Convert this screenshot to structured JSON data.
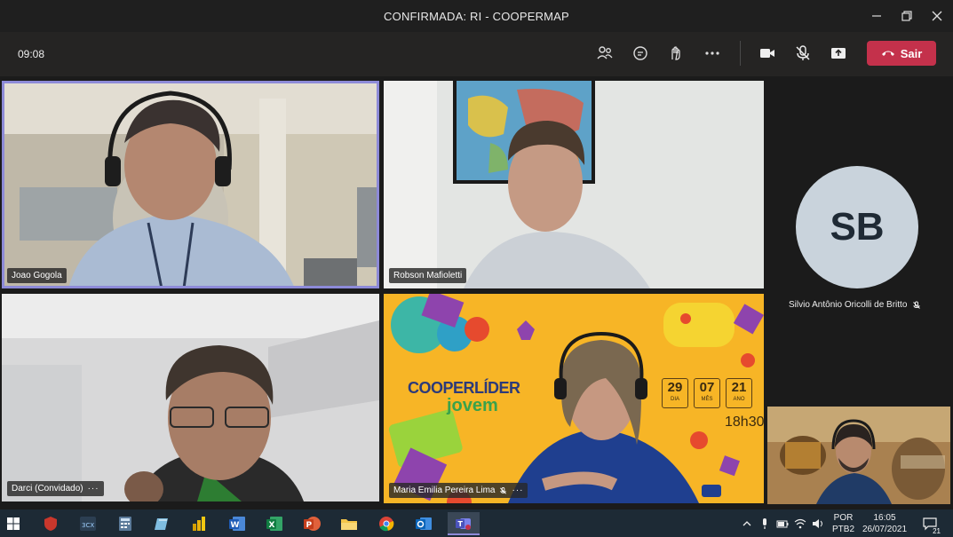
{
  "window": {
    "title": "CONFIRMADA: RI - COOPERMAP"
  },
  "toolbar": {
    "timer": "09:08",
    "leave_label": "Sair"
  },
  "participants": [
    {
      "name": "Joao Gogola"
    },
    {
      "name": "Robson Mafioletti"
    },
    {
      "name": "Darci (Convidado)"
    },
    {
      "name": "Maria Emilia Pereira Lima"
    },
    {
      "name": "Silvio Antônio Oricolli de Britto",
      "initials": "SB"
    }
  ],
  "banner": {
    "brand_line1": "COOPERLÍDER",
    "brand_line2": "jovem",
    "date_day": "29",
    "date_day_label": "DIA",
    "date_month": "07",
    "date_month_label": "MÊS",
    "date_year": "21",
    "date_year_label": "ANO",
    "time": "18h30"
  },
  "taskbar": {
    "lang_top": "POR",
    "lang_bottom": "PTB2",
    "clock_time": "16:05",
    "clock_date": "26/07/2021",
    "notif_count": "21"
  },
  "colors": {
    "leave": "#c4314b",
    "active_outline": "#8d8ad8",
    "banner_bg": "#f7b526"
  }
}
